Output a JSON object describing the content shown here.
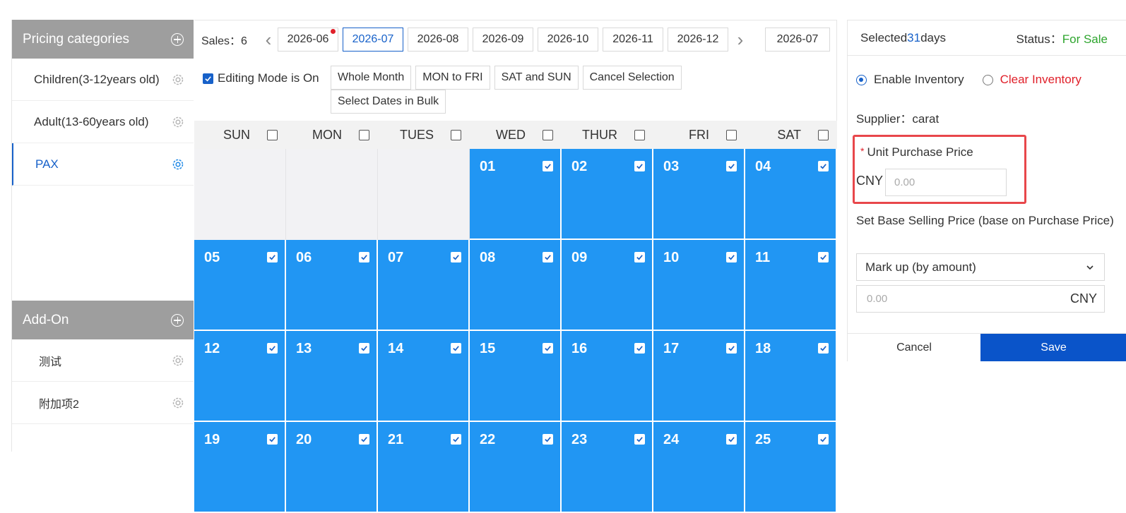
{
  "sidebar": {
    "pricing_title": "Pricing categories",
    "pricing_items": [
      {
        "label": "Children(3-12years old)"
      },
      {
        "label": "Adult(13-60years old)"
      },
      {
        "label": "PAX"
      }
    ],
    "addon_title": "Add-On",
    "addon_items": [
      {
        "label": "测试"
      },
      {
        "label": "附加项2"
      }
    ]
  },
  "calendar": {
    "sales_label": "Sales：6",
    "months": [
      "2026-06",
      "2026-07",
      "2026-08",
      "2026-09",
      "2026-10",
      "2026-11",
      "2026-12"
    ],
    "active_month": "2026-07",
    "current_month": "2026-07",
    "editing_mode_label": "Editing Mode is On",
    "editing_mode_on": true,
    "tools": [
      "Whole Month",
      "MON to FRI",
      "SAT and SUN",
      "Cancel Selection",
      "Select Dates in Bulk"
    ],
    "weekdays": [
      "SUN",
      "MON",
      "TUES",
      "WED",
      "THUR",
      "FRI",
      "SAT"
    ],
    "weeks": [
      [
        "",
        "",
        "",
        "01",
        "02",
        "03",
        "04"
      ],
      [
        "05",
        "06",
        "07",
        "08",
        "09",
        "10",
        "11"
      ],
      [
        "12",
        "13",
        "14",
        "15",
        "16",
        "17",
        "18"
      ],
      [
        "19",
        "20",
        "21",
        "22",
        "23",
        "24",
        "25"
      ]
    ]
  },
  "panel": {
    "selected_prefix": "Selected",
    "selected_count": "31",
    "selected_suffix": "days",
    "status_label": "Status：",
    "status_value": "For Sale",
    "enable_inventory": "Enable Inventory",
    "clear_inventory": "Clear Inventory",
    "supplier": "Supplier：carat",
    "required_mark": "*",
    "unit_purchase_price": "Unit Purchase Price",
    "currency": "CNY",
    "purchase_placeholder": "0.00",
    "base_selling_label": "Set Base Selling Price (base on Purchase Price)",
    "markup_select": "Mark up (by amount)",
    "price_placeholder": "0.00",
    "price_unit": "CNY",
    "cancel": "Cancel",
    "save": "Save"
  },
  "colors": {
    "selected_day": "#2196f3",
    "primary": "#1761c9",
    "save_button": "#0a54c9",
    "status_green": "#2ea52e",
    "danger_red": "#e0202a",
    "highlight_border": "#e8474b",
    "sidebar_header": "#9e9e9e"
  }
}
